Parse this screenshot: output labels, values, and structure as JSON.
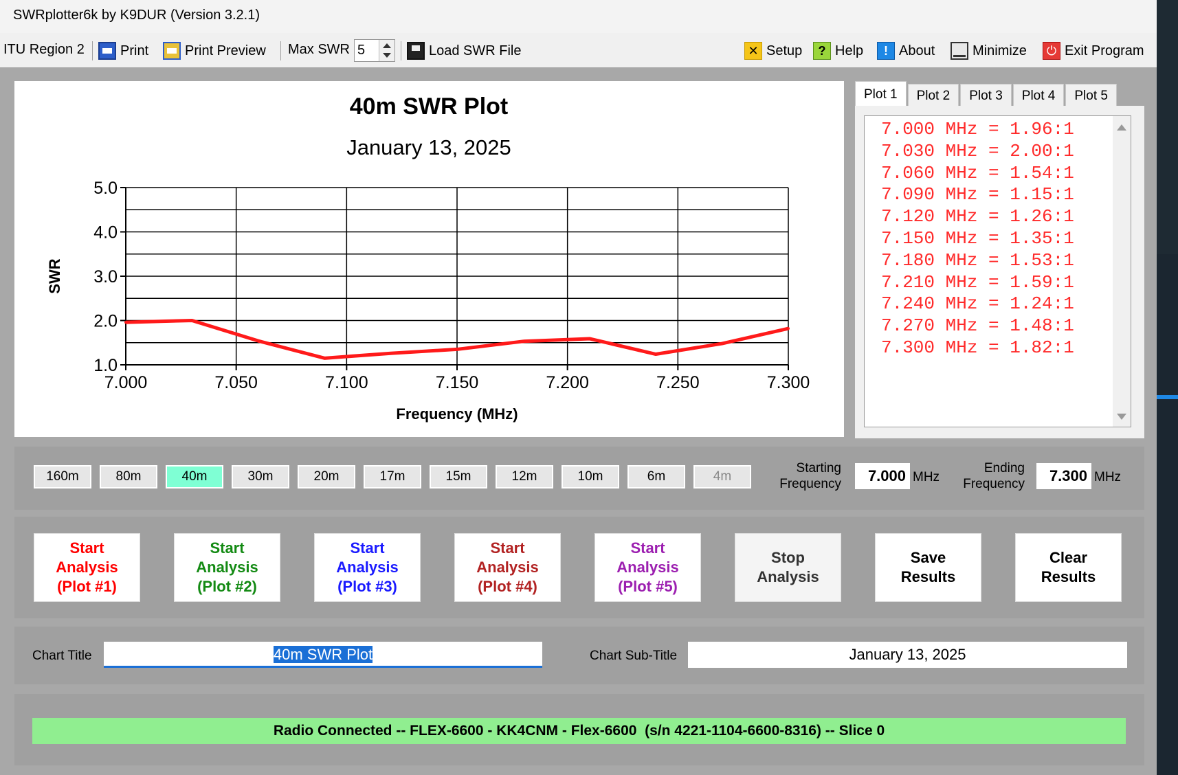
{
  "window": {
    "title": "SWRplotter6k by K9DUR (Version 3.2.1)"
  },
  "toolbar": {
    "region": "ITU Region 2",
    "print": "Print",
    "print_preview": "Print Preview",
    "max_swr_label": "Max SWR",
    "max_swr_value": "5",
    "load": "Load SWR File",
    "setup": "Setup",
    "help": "Help",
    "about": "About",
    "minimize": "Minimize",
    "exit": "Exit Program"
  },
  "chart_data": {
    "type": "line",
    "title": "40m SWR Plot",
    "subtitle": "January 13, 2025",
    "xlabel": "Frequency (MHz)",
    "ylabel": "SWR",
    "xlim": [
      7.0,
      7.3
    ],
    "ylim": [
      1.0,
      5.0
    ],
    "xticks": [
      "7.000",
      "7.050",
      "7.100",
      "7.150",
      "7.200",
      "7.250",
      "7.300"
    ],
    "yticks": [
      "5.0",
      "4.0",
      "3.0",
      "2.0",
      "1.0"
    ],
    "grid": true,
    "series": [
      {
        "color": "#ff1a1a",
        "x": [
          7.0,
          7.03,
          7.06,
          7.09,
          7.12,
          7.15,
          7.18,
          7.21,
          7.24,
          7.27,
          7.3
        ],
        "y": [
          1.96,
          2.0,
          1.54,
          1.15,
          1.26,
          1.35,
          1.53,
          1.59,
          1.24,
          1.48,
          1.82
        ]
      }
    ]
  },
  "tabs": [
    "Plot 1",
    "Plot 2",
    "Plot 3",
    "Plot 4",
    "Plot 5"
  ],
  "results": [
    "7.000 MHz = 1.96:1",
    "7.030 MHz = 2.00:1",
    "7.060 MHz = 1.54:1",
    "7.090 MHz = 1.15:1",
    "7.120 MHz = 1.26:1",
    "7.150 MHz = 1.35:1",
    "7.180 MHz = 1.53:1",
    "7.210 MHz = 1.59:1",
    "7.240 MHz = 1.24:1",
    "7.270 MHz = 1.48:1",
    "7.300 MHz = 1.82:1"
  ],
  "bands": [
    "160m",
    "80m",
    "40m",
    "30m",
    "20m",
    "17m",
    "15m",
    "12m",
    "10m",
    "6m",
    "4m"
  ],
  "selected_band": "40m",
  "disabled_band": "4m",
  "band_highlight_color": "#7fffd4",
  "freq": {
    "start_label_1": "Starting",
    "start_label_2": "Frequency",
    "start_value": "7.000",
    "end_label_1": "Ending",
    "end_label_2": "Frequency",
    "end_value": "7.300",
    "unit": "MHz"
  },
  "actions": {
    "start1": [
      "Start",
      "Analysis",
      "(Plot #1)"
    ],
    "start2": [
      "Start",
      "Analysis",
      "(Plot #2)"
    ],
    "start3": [
      "Start",
      "Analysis",
      "(Plot #3)"
    ],
    "start4": [
      "Start",
      "Analysis",
      "(Plot #4)"
    ],
    "start5": [
      "Start",
      "Analysis",
      "(Plot #5)"
    ],
    "stop": [
      "Stop",
      "Analysis"
    ],
    "save": [
      "Save",
      "Results"
    ],
    "clear": [
      "Clear",
      "Results"
    ]
  },
  "plot_colors": [
    "#ff0000",
    "#138a13",
    "#1a1aff",
    "#b22222",
    "#9c1fb0"
  ],
  "titles": {
    "chart_title_label": "Chart Title",
    "chart_title_value": "40m SWR Plot",
    "chart_subtitle_label": "Chart Sub-Title",
    "chart_subtitle_value": "January 13, 2025"
  },
  "status": "Radio Connected -- FLEX-6600 - KK4CNM - Flex-6600  (s/n 4221-1104-6600-8316) -- Slice 0",
  "status_color": "#90ee90"
}
